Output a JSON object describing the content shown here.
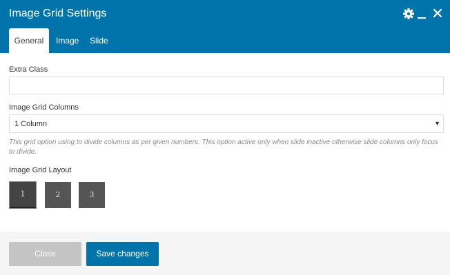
{
  "dialog": {
    "title": "Image Grid Settings",
    "header_icons": [
      "gear-icon",
      "minimize-icon",
      "close-icon"
    ],
    "colors": {
      "header": "#0073aa",
      "primary_button": "#0073aa",
      "secondary_button": "#c4c4c4",
      "layout_button": "#555555"
    }
  },
  "tabs": [
    {
      "label": "General",
      "active": true
    },
    {
      "label": "Image",
      "active": false
    },
    {
      "label": "Slide",
      "active": false
    }
  ],
  "fields": {
    "extra_class": {
      "label": "Extra Class",
      "value": ""
    },
    "grid_columns": {
      "label": "Image Grid Columns",
      "selected": "1 Column",
      "help": "This grid option using to divide columns as per given numbers. This option active only when slide inactive otherwise slide columns only focus to divide."
    },
    "grid_layout": {
      "label": "Image Grid Layout",
      "options": [
        "1",
        "2",
        "3"
      ],
      "selected": "1"
    }
  },
  "footer": {
    "close_label": "Close",
    "save_label": "Save changes"
  }
}
